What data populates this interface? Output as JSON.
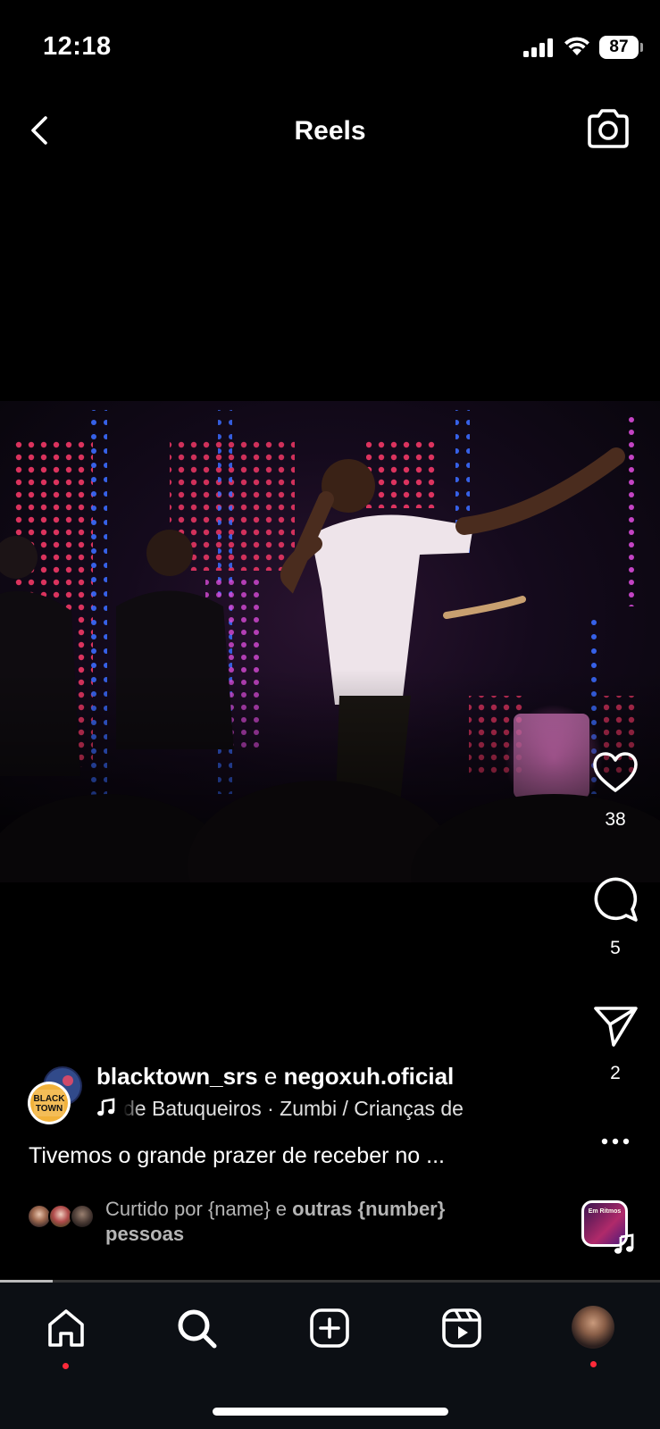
{
  "status_bar": {
    "time": "12:18",
    "battery": "87"
  },
  "header": {
    "title": "Reels"
  },
  "post": {
    "author_primary": "blacktown_srs",
    "conjunction": "e",
    "author_secondary": "negoxuh.oficial",
    "audio_text": "de Batuqueiros · Zumbi / Crianças de",
    "caption": "Tivemos o grande prazer de receber no ...",
    "likes_prefix": "Curtido por {name} e",
    "likes_bold": "outras {number}",
    "likes_suffix": "pessoas",
    "avatar_logo_line1": "BLACK",
    "avatar_logo_line2": "TOWN",
    "audio_thumb_text": "Em Ritmos"
  },
  "actions": {
    "likes": "38",
    "comments": "5",
    "shares": "2"
  },
  "playback": {
    "progress": 0.08
  },
  "colors": {
    "notification_dot": "#ff2a3a",
    "background": "#000000"
  },
  "icons": [
    "back-icon",
    "camera-icon",
    "heart-icon",
    "comment-icon",
    "send-icon",
    "more-icon",
    "music-note-icon",
    "home-icon",
    "search-icon",
    "create-icon",
    "reels-icon"
  ]
}
